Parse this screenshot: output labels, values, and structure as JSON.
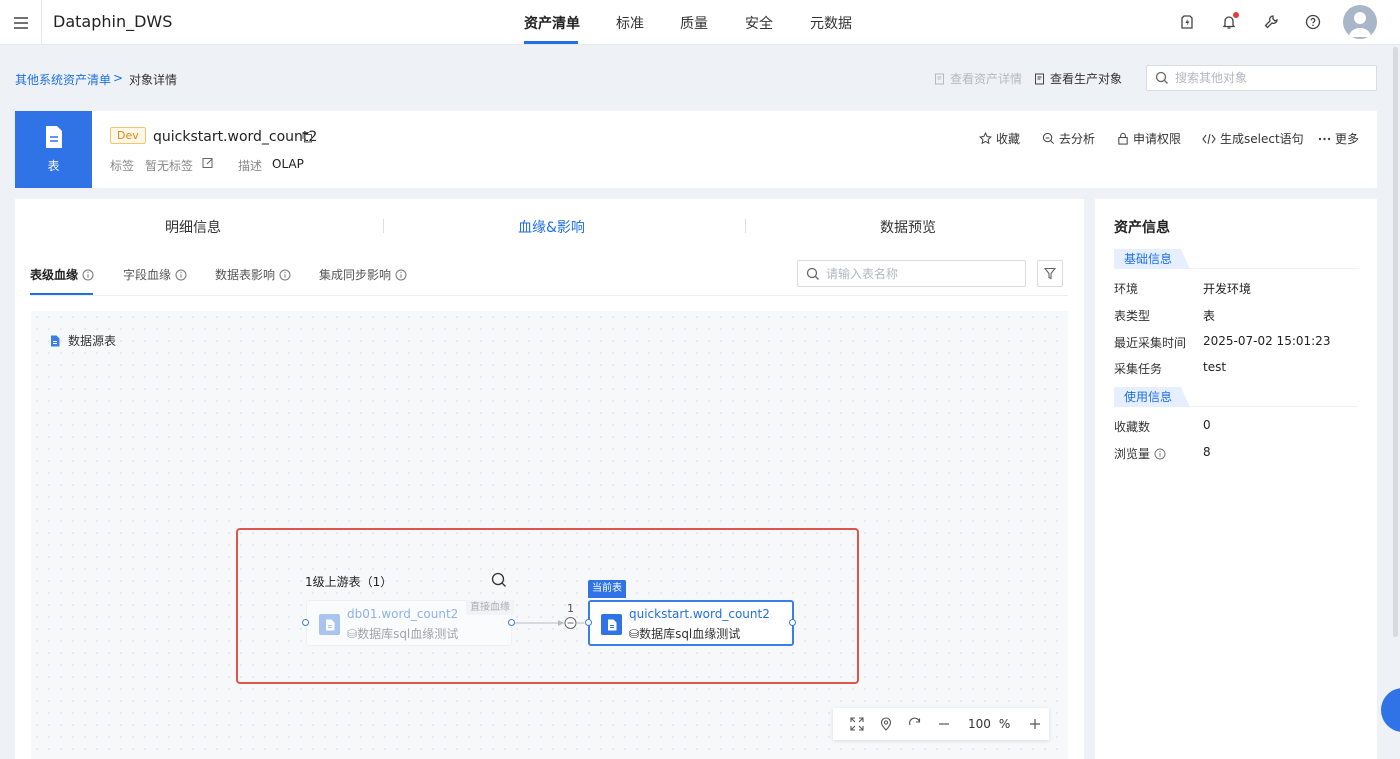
{
  "app": {
    "title": "Dataphin_DWS"
  },
  "topnav": {
    "tabs": [
      {
        "label": "资产清单",
        "active": true
      },
      {
        "label": "标准"
      },
      {
        "label": "质量"
      },
      {
        "label": "安全"
      },
      {
        "label": "元数据"
      }
    ],
    "icons": [
      "rocket-icon",
      "bell-icon",
      "wrench-icon",
      "help-icon"
    ]
  },
  "breadcrumb": {
    "parent": "其他系统资产清单",
    "sep": ">",
    "current": "对象详情"
  },
  "toolbar": {
    "view_asset_detail": "查看资产详情",
    "view_prod_object": "查看生产对象",
    "search_placeholder": "搜索其他对象"
  },
  "object": {
    "type_label": "表",
    "env_badge": "Dev",
    "name": "quickstart.word_count2",
    "tags_label": "标签",
    "tags_value": "暂无标签",
    "desc_label": "描述",
    "desc_value": "OLAP",
    "actions": [
      "收藏",
      "去分析",
      "申请权限",
      "生成select语句",
      "更多"
    ]
  },
  "main_tabs": [
    {
      "label": "明细信息"
    },
    {
      "label": "血缘&影响",
      "active": true
    },
    {
      "label": "数据预览"
    }
  ],
  "sub_tabs": [
    {
      "label": "表级血缘",
      "active": true
    },
    {
      "label": "字段血缘"
    },
    {
      "label": "数据表影响"
    },
    {
      "label": "集成同步影响"
    }
  ],
  "table_search_placeholder": "请输入表名称",
  "lineage": {
    "legend": "数据源表",
    "upstream_title": "1级上游表（1）",
    "upstream_node": {
      "name": "db01.word_count2",
      "db": "数据库sql血缘测试",
      "tag": "直接血缘"
    },
    "edge_count": "1",
    "current_label": "当前表",
    "current_node": {
      "name": "quickstart.word_count2",
      "db": "数据库sql血缘测试"
    }
  },
  "zoom": {
    "value": "100",
    "unit": "%"
  },
  "asset_info": {
    "title": "资产信息",
    "basic_section": "基础信息",
    "basic": [
      {
        "label": "环境",
        "value": "开发环境"
      },
      {
        "label": "表类型",
        "value": "表"
      },
      {
        "label": "最近采集时间",
        "value": "2025-07-02 15:01:23"
      },
      {
        "label": "采集任务",
        "value": "test"
      }
    ],
    "usage_section": "使用信息",
    "usage": [
      {
        "label": "收藏数",
        "value": "0"
      },
      {
        "label": "浏览量",
        "value": "8"
      }
    ]
  },
  "colors": {
    "accent": "#1f6fe5",
    "highlight": "#e0554b",
    "badge": "#e08a0f"
  }
}
